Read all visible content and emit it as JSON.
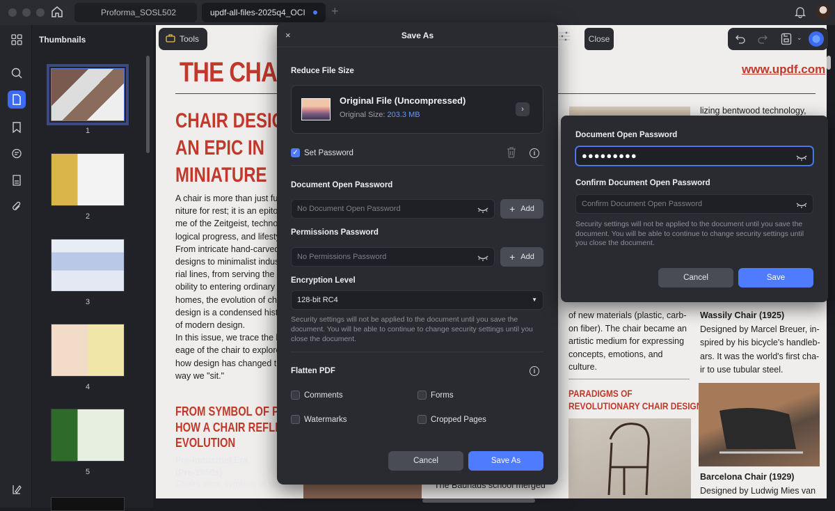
{
  "tabs": [
    {
      "label": "Proforma_SOSL502"
    },
    {
      "label": "updf-all-files-2025q4_OCI"
    }
  ],
  "sidebar": {
    "title": "Thumbnails",
    "pages": [
      "1",
      "2",
      "3",
      "4",
      "5"
    ]
  },
  "toolbar": {
    "tools_label": "Tools",
    "close_label": "Close"
  },
  "document": {
    "big_title": "THE CHA",
    "url": "www.updf.com",
    "headline": [
      "CHAIR DESIG",
      "AN EPIC IN",
      "MINIATURE"
    ],
    "body_lines": [
      "A chair is more than just fur",
      "niture for rest; it is an epito-",
      "me of the Zeitgeist, techno-",
      "logical progress, and lifesty",
      "From intricate hand-carved",
      "designs to minimalist indust",
      "rial lines, from serving the r",
      "obility to entering ordinary",
      "homes, the evolution of cha",
      "design is a condensed histo",
      "of modern design.",
      "In this issue, we trace the li",
      "eage of the chair to explore",
      "how design has changed th",
      "way we \"sit.\""
    ],
    "subhead": [
      "FROM SYMBOL OF POW",
      "HOW A CHAIR REFLEC",
      "EVOLUTION"
    ],
    "era_title": [
      "Pre-Industrial Era",
      " (Pre-1850s)"
    ],
    "era_body": "Chairs were symbols of status",
    "right_top": "lizing bentwood technology,",
    "mid_lines": [
      "of new materials (plastic, carb-",
      "on fiber). The chair became an",
      "artistic medium for expressing",
      "concepts, emotions, and",
      "culture."
    ],
    "paradigms": [
      "PARADIGMS OF",
      "REVOLUTIONARY CHAIR DESIGN"
    ],
    "bauhaus": "The Bauhaus school merged",
    "wassily_title": "Wassily Chair (1925)",
    "wassily_lines": [
      "Designed by Marcel Breuer, in-",
      "spired by his bicycle's handleb-",
      "ars. It was the world's first cha-",
      "ir to use tubular steel."
    ],
    "barcelona_title": "Barcelona Chair (1929)",
    "barcelona_body": "Designed by Ludwig Mies van"
  },
  "save_dialog": {
    "close": "×",
    "title": "Save As",
    "reduce_label": "Reduce File Size",
    "file_name": "Original File (Uncompressed)",
    "file_size_label": "Original Size: ",
    "file_size_value": "203.3 MB",
    "set_password_label": "Set Password",
    "set_password_checked": true,
    "open_pw_label": "Document Open Password",
    "open_pw_placeholder": "No Document Open Password",
    "perm_pw_label": "Permissions Password",
    "perm_pw_placeholder": "No Permissions Password",
    "add_label": "Add",
    "encryption_label": "Encryption Level",
    "encryption_value": "128-bit RC4",
    "note": "Security settings will not be applied to the document until you save the document. You will be able to continue to change security settings until you close the document.",
    "flatten_label": "Flatten PDF",
    "flatten_options": [
      {
        "label": "Comments",
        "checked": false
      },
      {
        "label": "Forms",
        "checked": false
      },
      {
        "label": "Watermarks",
        "checked": false
      },
      {
        "label": "Cropped Pages",
        "checked": false
      }
    ],
    "cancel_label": "Cancel",
    "save_as_label": "Save As"
  },
  "password_popover": {
    "open_label": "Document Open Password",
    "open_value": "●●●●●●●●●",
    "confirm_label": "Confirm Document Open Password",
    "confirm_placeholder": "Confirm Document Open Password",
    "note": "Security settings will not be applied to the document until you save the document. You will be able to continue to change security settings until you close the document.",
    "cancel_label": "Cancel",
    "save_label": "Save"
  },
  "colors": {
    "accent": "#4f7cff",
    "doc_red": "#c0392b",
    "dialog_bg": "#2a2b31"
  }
}
